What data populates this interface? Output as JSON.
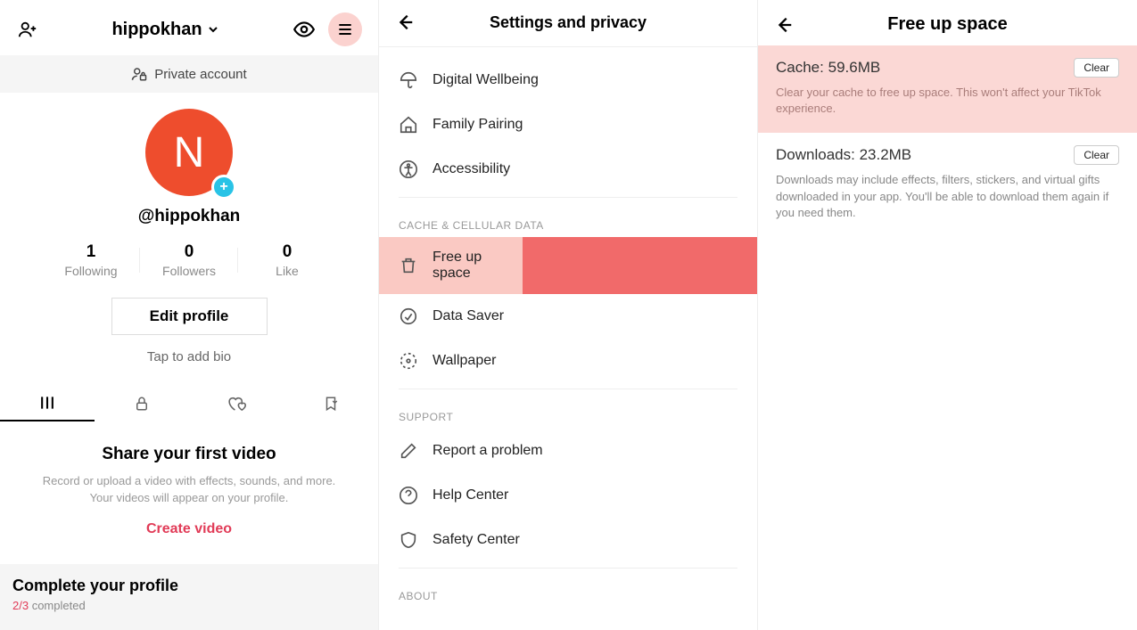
{
  "profile": {
    "display_name": "hippokhan",
    "private_label": "Private account",
    "avatar_letter": "N",
    "handle": "@hippokhan",
    "stats": {
      "following_val": "1",
      "following_lbl": "Following",
      "followers_val": "0",
      "followers_lbl": "Followers",
      "likes_val": "0",
      "likes_lbl": "Like"
    },
    "edit_label": "Edit profile",
    "bio_placeholder": "Tap to add bio",
    "cta": {
      "title": "Share your first video",
      "sub": "Record or upload a video with effects, sounds, and more. Your videos will appear on your profile.",
      "action": "Create video"
    },
    "complete": {
      "title": "Complete your profile",
      "done": "2/3",
      "rest": " completed"
    }
  },
  "settings": {
    "title": "Settings and privacy",
    "items1": {
      "a": "Digital Wellbeing",
      "b": "Family Pairing",
      "c": "Accessibility"
    },
    "sec_cache": "CACHE & CELLULAR DATA",
    "items2": {
      "a": "Free up space",
      "b": "Data Saver",
      "c": "Wallpaper"
    },
    "sec_support": "SUPPORT",
    "items3": {
      "a": "Report a problem",
      "b": "Help Center",
      "c": "Safety Center"
    },
    "sec_about": "ABOUT"
  },
  "space": {
    "title": "Free up space",
    "cache": {
      "label": "Cache:",
      "size": "59.6MB",
      "desc": "Clear your cache to free up space. This won't affect your TikTok experience."
    },
    "downloads": {
      "label": "Downloads:",
      "size": "23.2MB",
      "desc": "Downloads may include effects, filters, stickers, and virtual gifts downloaded in your app. You'll be able to download them again if you need them."
    },
    "clear_btn": "Clear"
  }
}
